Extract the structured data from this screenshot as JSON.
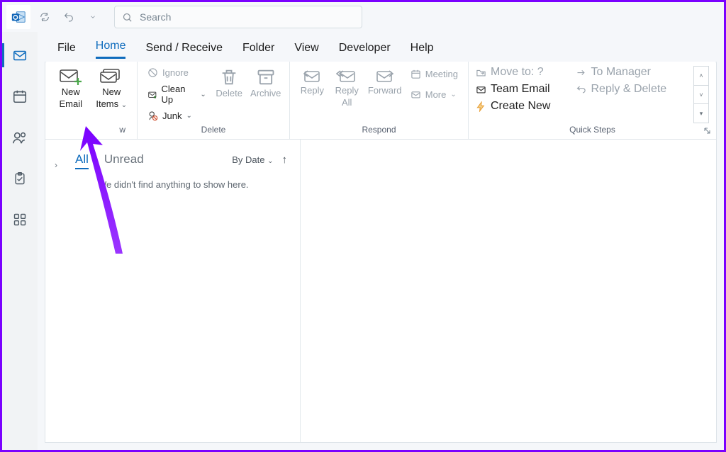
{
  "title_bar": {
    "search_placeholder": "Search"
  },
  "tabs": {
    "file": "File",
    "home": "Home",
    "send_receive": "Send / Receive",
    "folder": "Folder",
    "view": "View",
    "developer": "Developer",
    "help": "Help"
  },
  "ribbon": {
    "new": {
      "new_email_l1": "New",
      "new_email_l2": "Email",
      "new_items_l1": "New",
      "new_items_l2": "Items",
      "group_label": "w"
    },
    "delete": {
      "ignore": "Ignore",
      "clean_up": "Clean Up",
      "junk": "Junk",
      "delete": "Delete",
      "archive": "Archive",
      "group_label": "Delete"
    },
    "respond": {
      "reply": "Reply",
      "reply_all_l1": "Reply",
      "reply_all_l2": "All",
      "forward": "Forward",
      "meeting": "Meeting",
      "more": "More",
      "group_label": "Respond"
    },
    "quick_steps": {
      "move_to": "Move to: ?",
      "team_email": "Team Email",
      "create_new": "Create New",
      "to_manager": "To Manager",
      "reply_delete": "Reply & Delete",
      "group_label": "Quick Steps"
    }
  },
  "message_list": {
    "filter_all": "All",
    "filter_unread": "Unread",
    "sort_label": "By Date",
    "empty_text": "We didn't find anything to show here."
  }
}
